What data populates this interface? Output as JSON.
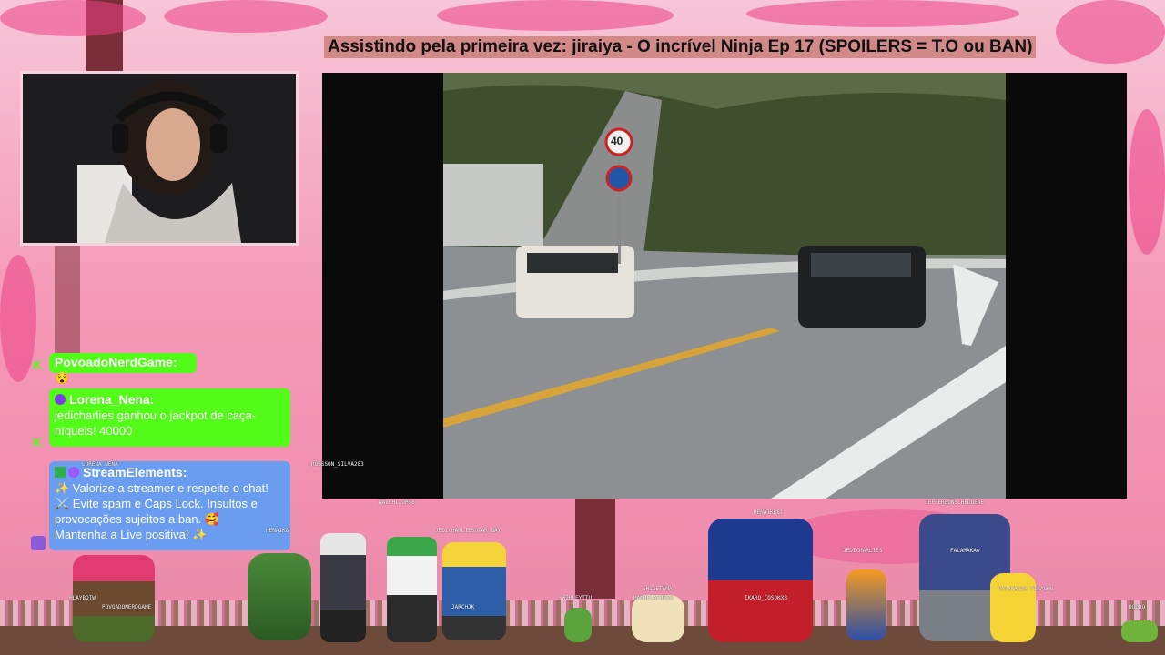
{
  "stream": {
    "title": "Assistindo pela primeira vez: jiraiya - O incrível Ninja Ep 17  (SPOILERS = T.O ou BAN)"
  },
  "video": {
    "sign_speed": "40"
  },
  "chat": [
    {
      "user": "PovoadoNerdGame:",
      "emote": "😵",
      "message": "",
      "platform": "kick"
    },
    {
      "user": "Lorena_Nena:",
      "message": "jedicharlies ganhou o jackpot de caça-níqueis! 40000",
      "platform": "kick"
    },
    {
      "user": "StreamElements:",
      "message_lines": [
        "✨ Valorize a streamer e respeite o chat!",
        "⚔️ Evite spam e Caps Lock. Insultos e provocações sujeitos a ban. 🥰",
        "Mantenha a Live positiva! ✨"
      ],
      "platform": "twitch"
    }
  ],
  "overlay_names": {
    "lorena": "LORENA_NENA",
    "robson": "ROBSSON_SILVA283",
    "nalchi": "NALCHI-OPS8",
    "henaik": "HENAIK8",
    "jedichar": "JEDICHARLIESUTAR_BAY",
    "henaik81": "HENAIKK81",
    "jeffer": "JEFFERSONSCHEDUENE",
    "jedicharlies": "JEDICHARLIES",
    "playbot": "PLAYBOTW",
    "povoado": "POVOADONERDGAME",
    "jarchik": "JARCHJK",
    "swibley": "SWIBLEYTTU",
    "shigetama": "SHIGETAMA",
    "manoel": "MANOELAFONSO",
    "ikaro": "IKARO_COSDKX8",
    "falamakao": "FALAMAKAO",
    "tatakassa": "TATAKASSA PIKACHU",
    "doddo": "DODDO"
  },
  "colors": {
    "kick_green": "#53fc18",
    "twitch_blue": "#6a9cf0",
    "title_bg": "#c4786e"
  }
}
